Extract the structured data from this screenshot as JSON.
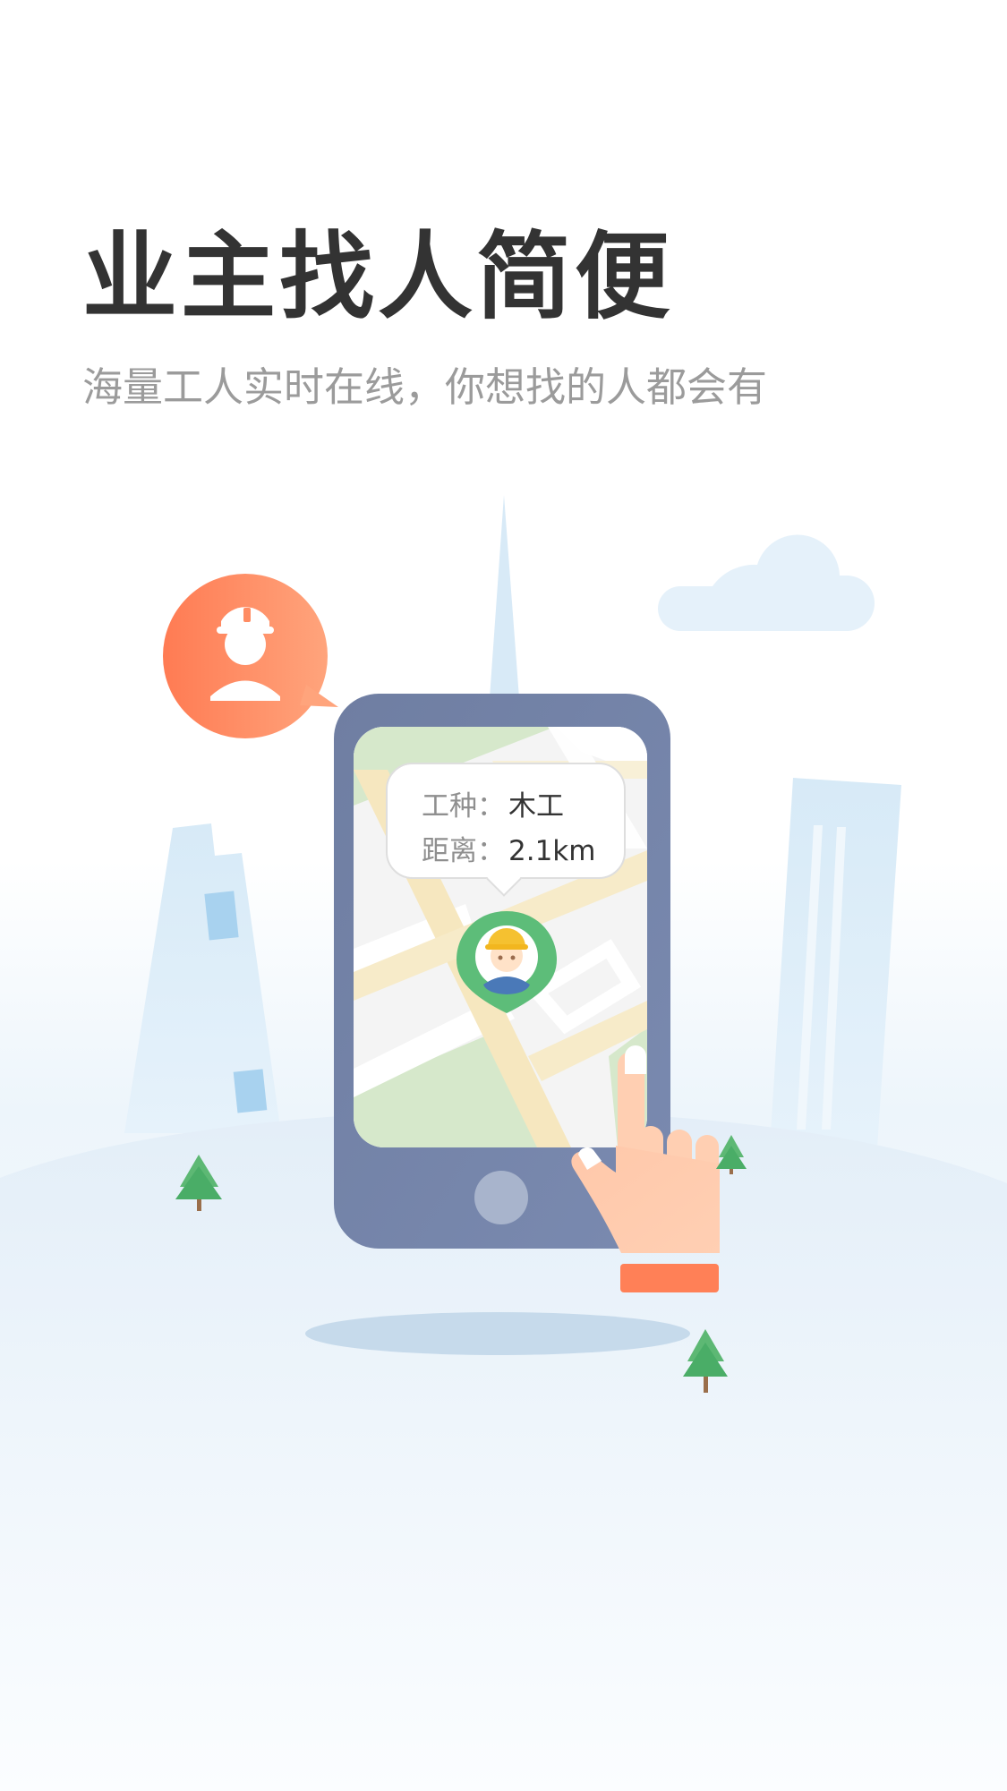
{
  "headline": "业主找人简便",
  "subtitle": "海量工人实时在线，你想找的人都会有",
  "popup": {
    "trade_label": "工种：",
    "trade_value": "木工",
    "distance_label": "距离：",
    "distance_value": "2.1km"
  },
  "colors": {
    "headline_text": "#333333",
    "subtitle_text": "#9b9b9b",
    "phone_frame": "#6f7fa2",
    "accent_orange": "#ff8058",
    "map_green": "#d5e8c9",
    "map_road": "#f6e7bd",
    "tree_green": "#55b872"
  },
  "icons": {
    "speech_bubble": "worker-helmet-icon",
    "map_marker": "worker-location-pin-icon"
  }
}
